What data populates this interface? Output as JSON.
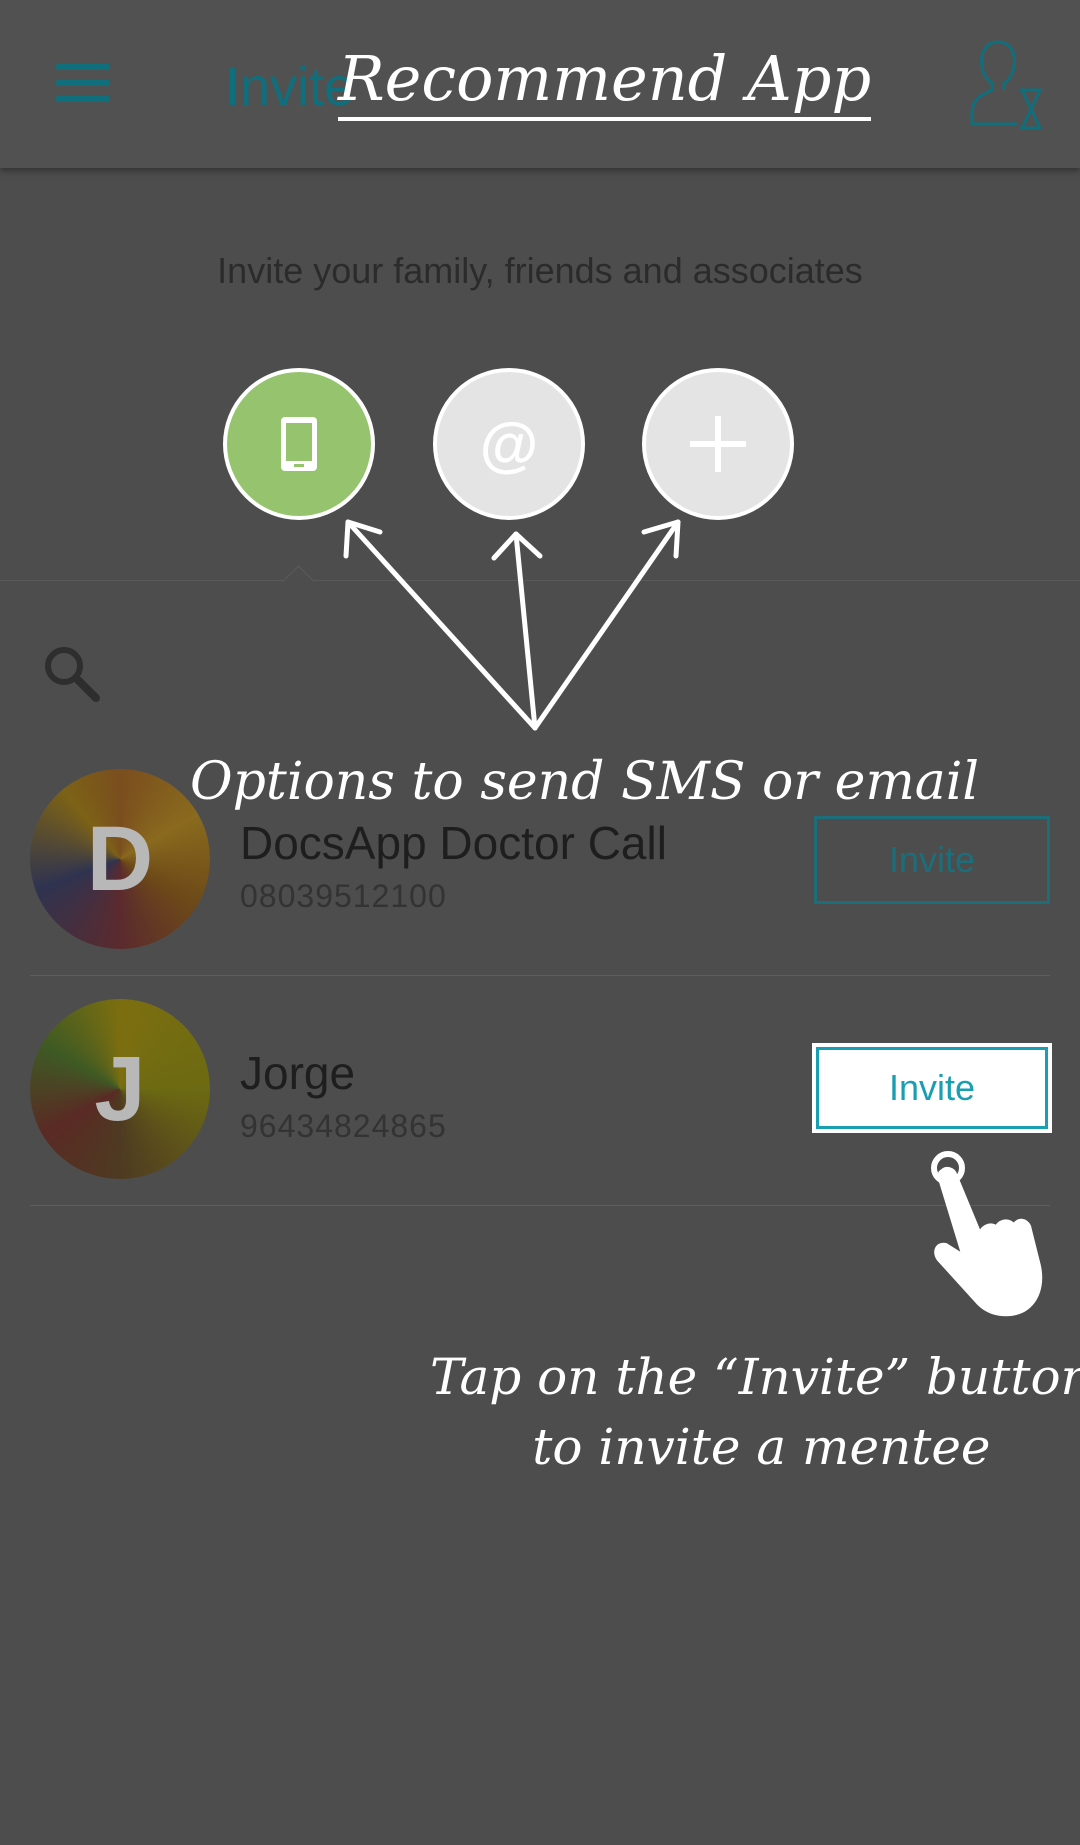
{
  "header": {
    "title": "Invite",
    "menu_icon": "menu-icon",
    "profile_icon": "user-profile-icon"
  },
  "invite_section": {
    "subtitle": "Invite your family, friends and associates",
    "options": [
      {
        "name": "sms",
        "icon": "mobile-phone-icon",
        "color": "#96c46e"
      },
      {
        "name": "email",
        "icon": "at-sign-icon",
        "glyph": "@"
      },
      {
        "name": "add",
        "icon": "plus-icon"
      }
    ]
  },
  "search": {
    "icon": "search-icon"
  },
  "contacts": [
    {
      "initial": "D",
      "name": "DocsApp Doctor Call",
      "phone": "08039512100",
      "invite_label": "Invite"
    },
    {
      "initial": "J",
      "name": "Jorge",
      "phone": "96434824865",
      "invite_label": "Invite"
    }
  ],
  "annotations": {
    "title": "Recommend App",
    "options_note": "Options to send SMS or email",
    "tap_note_line1": "Tap on the “Invite” button",
    "tap_note_line2": "to invite a mentee"
  },
  "colors": {
    "accent": "#0f6f7c",
    "highlight_invite": "#1a9fb2",
    "overlay": "#4d4d4d"
  }
}
